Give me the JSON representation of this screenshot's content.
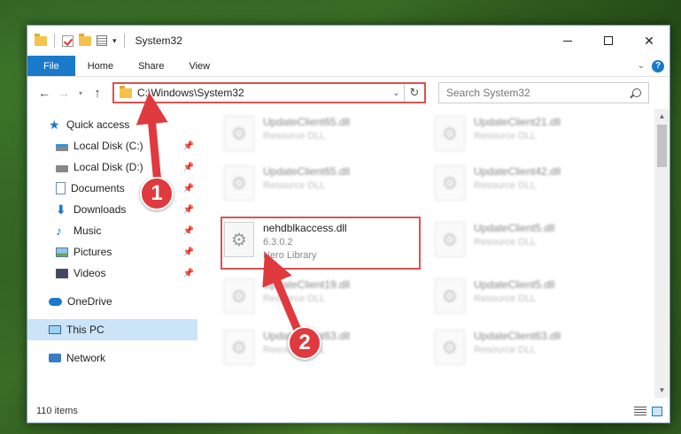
{
  "window": {
    "title": "System32",
    "min_glyph": "",
    "max_glyph": "",
    "close_glyph": "✕"
  },
  "ribbon": {
    "tabs": [
      "File",
      "Home",
      "Share",
      "View"
    ]
  },
  "address": {
    "path": "C:\\Windows\\System32",
    "search_placeholder": "Search System32"
  },
  "sidebar": {
    "quick_access": "Quick access",
    "items": [
      {
        "label": "Local Disk (C:)"
      },
      {
        "label": "Local Disk (D:)"
      },
      {
        "label": "Documents"
      },
      {
        "label": "Downloads"
      },
      {
        "label": "Music"
      },
      {
        "label": "Pictures"
      },
      {
        "label": "Videos"
      }
    ],
    "onedrive": "OneDrive",
    "this_pc": "This PC",
    "network": "Network"
  },
  "files": {
    "selected": {
      "name": "nehdblkaccess.dll",
      "version": "6.3.0.2",
      "desc": "Nero Library"
    },
    "others": [
      {
        "name": "UpdateClient65.dll",
        "desc": "Resource DLL"
      },
      {
        "name": "UpdateClient21.dll",
        "desc": "Resource DLL"
      },
      {
        "name": "UpdateClient65.dll",
        "desc": "Resource DLL"
      },
      {
        "name": "UpdateClient42.dll",
        "desc": "Resource DLL"
      },
      {
        "name": "UpdateClient5.dll",
        "desc": "Resource DLL"
      },
      {
        "name": "UpdateClient19.dll",
        "desc": "Resource DLL"
      },
      {
        "name": "UpdateClient5.dll",
        "desc": "Resource DLL"
      },
      {
        "name": "UpdateClient63.dll",
        "desc": "Resource DLL"
      },
      {
        "name": "UpdateClient63.dll",
        "desc": "Resource DLL"
      }
    ]
  },
  "status": {
    "item_count": "110 items"
  },
  "annotations": {
    "step1": "1",
    "step2": "2"
  },
  "colors": {
    "accent": "#1979ca",
    "highlight": "#d9534f",
    "badge": "#e0393e"
  }
}
